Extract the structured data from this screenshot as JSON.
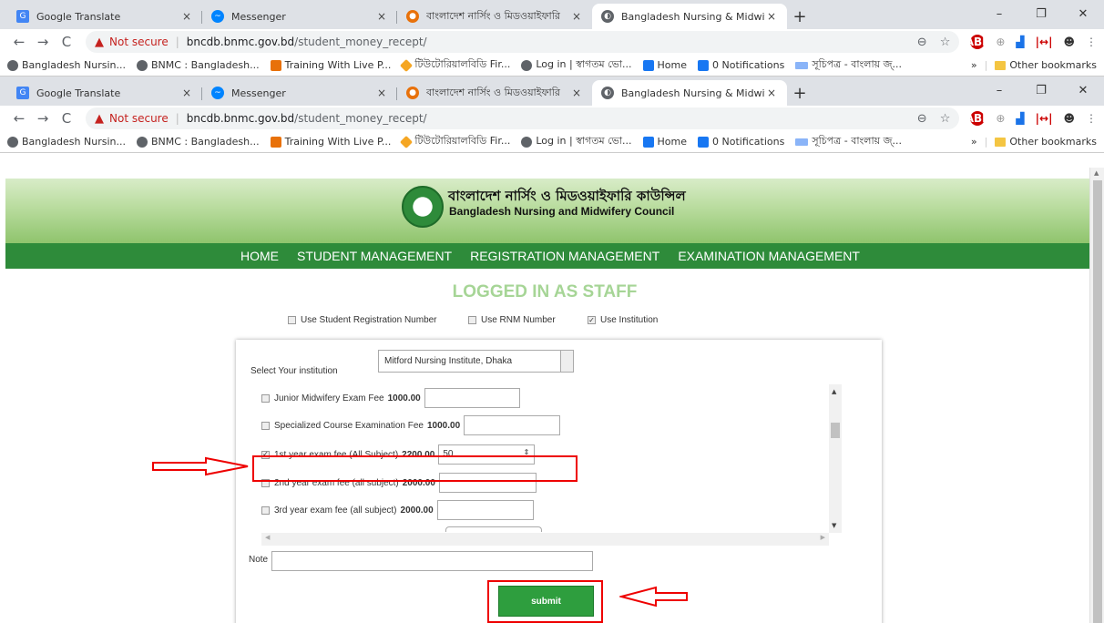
{
  "browser": {
    "tabs": [
      {
        "title": "Google Translate",
        "icon": "google-translate-icon",
        "active": false
      },
      {
        "title": "Messenger",
        "icon": "messenger-icon",
        "active": false
      },
      {
        "title": "বাংলাদেশ নার্সিং ও মিডওয়াইফারি",
        "icon": "bnmc-icon",
        "active": false
      },
      {
        "title": "Bangladesh Nursing & Midwifery",
        "icon": "globe-icon",
        "active": true
      }
    ],
    "tab_close": "×",
    "new_tab": "+",
    "window_controls": [
      "–",
      "❐",
      "✕"
    ],
    "url_warning": "Not secure",
    "url_host": "bncdb.bnmc.gov.bd",
    "url_path": "/student_money_recept/",
    "bookmarks": [
      {
        "label": "Bangladesh Nursin...",
        "icon": "globe-icon"
      },
      {
        "label": "BNMC : Bangladesh...",
        "icon": "globe-icon"
      },
      {
        "label": "Training With Live P...",
        "icon": "training-icon"
      },
      {
        "label": "টিউটোরিয়ালবিডি Fir...",
        "icon": "diamond-icon"
      },
      {
        "label": "Log in | স্বাগতম ভো...",
        "icon": "globe-icon"
      },
      {
        "label": "Home",
        "icon": "facebook-icon"
      },
      {
        "label": "0 Notifications",
        "icon": "facebook-icon"
      },
      {
        "label": "সূচিপত্র - বাংলায় জ্...",
        "icon": "site-icon"
      }
    ],
    "more_bookmarks": "»",
    "other_bookmarks": "Other bookmarks"
  },
  "site": {
    "title_bn": "বাংলাদেশ নার্সিং ও মিডওয়াইফারি কাউন্সিল",
    "title_en": "Bangladesh Nursing and Midwifery Council",
    "nav": [
      "HOME",
      "STUDENT MANAGEMENT",
      "REGISTRATION MANAGEMENT",
      "EXAMINATION MANAGEMENT"
    ],
    "heading": "LOGGED IN AS STAFF",
    "options": [
      {
        "label": "Use Student Registration Number",
        "checked": false
      },
      {
        "label": "Use RNM Number",
        "checked": false
      },
      {
        "label": "Use Institution",
        "checked": true
      }
    ]
  },
  "form": {
    "institution_label": "Select Your institution",
    "institution_value": "Mitford Nursing Institute, Dhaka",
    "fees": [
      {
        "label": "Junior Midwifery Exam Fee",
        "amount": "1000.00",
        "checked": false,
        "value": ""
      },
      {
        "label": "Specialized Course Examination Fee",
        "amount": "1000.00",
        "checked": false,
        "value": ""
      },
      {
        "label": "1st year exam fee (All Subject)",
        "amount": "2200.00",
        "checked": true,
        "value": "50"
      },
      {
        "label": "2nd year exam fee (all subject)",
        "amount": "2000.00",
        "checked": false,
        "value": ""
      },
      {
        "label": "3rd year exam fee (all subject)",
        "amount": "2000.00",
        "checked": false,
        "value": ""
      }
    ],
    "note_label": "Note",
    "submit_label": "submit"
  },
  "colors": {
    "nav_green": "#2e8b3a",
    "heading_green": "#a6d596",
    "highlight_red": "#e00000"
  }
}
